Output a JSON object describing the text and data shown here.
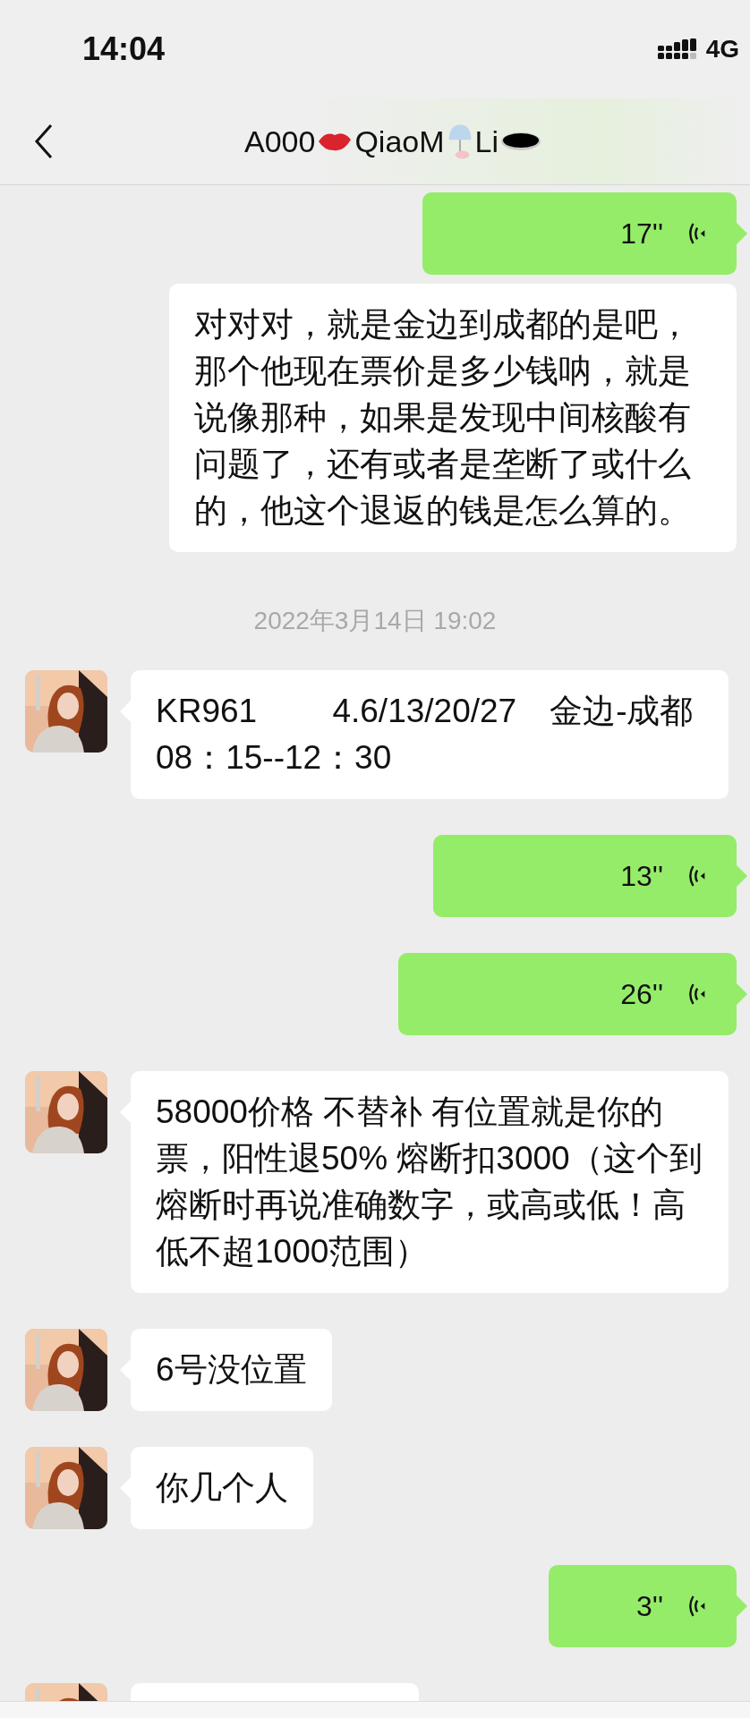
{
  "status_bar": {
    "time": "14:04",
    "network": "4G"
  },
  "header": {
    "title_parts": [
      "A000",
      "QiaoM",
      "Li"
    ]
  },
  "messages": [
    {
      "kind": "voice",
      "outgoing": true,
      "duration": "17''"
    },
    {
      "kind": "text",
      "outgoing": true,
      "text": "对对对，就是金边到成都的是吧，那个他现在票价是多少钱呐，就是说像那种，如果是发现中间核酸有问题了，还有或者是垄断了或什么的，他这个退返的钱是怎么算的。"
    },
    {
      "kind": "time",
      "text": "2022年3月14日 19:02"
    },
    {
      "kind": "text",
      "outgoing": false,
      "text": "KR961　　 4.6/13/20/27　金边-成都　08：15--12：30"
    },
    {
      "kind": "voice",
      "outgoing": true,
      "duration": "13''"
    },
    {
      "kind": "voice",
      "outgoing": true,
      "duration": "26''"
    },
    {
      "kind": "text",
      "outgoing": false,
      "text": "58000价格 不替补 有位置就是你的票，阳性退50% 熔断扣3000（这个到熔断时再说准确数字，或高或低！高低不超1000范围）"
    },
    {
      "kind": "text",
      "outgoing": false,
      "text": "6号没位置"
    },
    {
      "kind": "text",
      "outgoing": false,
      "text": "你几个人"
    },
    {
      "kind": "voice",
      "outgoing": true,
      "duration": "3''"
    },
    {
      "kind": "partial",
      "outgoing": false
    }
  ]
}
